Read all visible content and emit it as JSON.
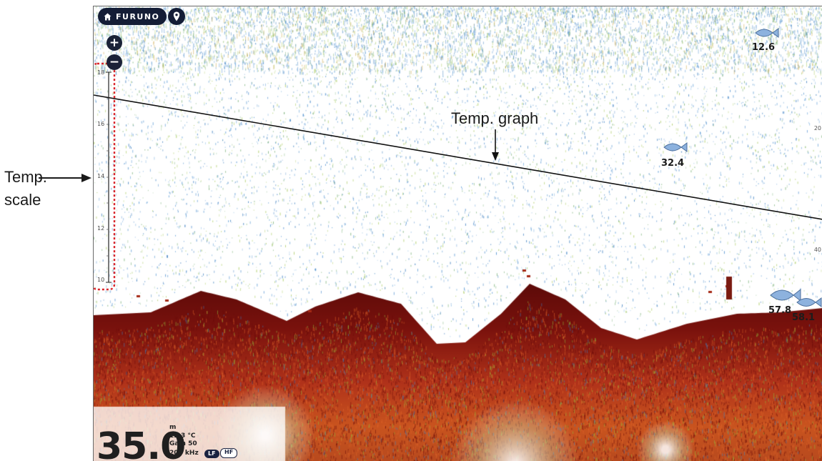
{
  "callouts": {
    "temp_scale_line1": "Temp.",
    "temp_scale_line2": "scale",
    "temp_graph": "Temp. graph"
  },
  "toolbar": {
    "brand": "FURUNO",
    "home_icon": "home-icon",
    "pin_icon": "location-pin-icon",
    "zoom_in": "+",
    "zoom_out": "−"
  },
  "temp_scale": {
    "ticks": [
      "18",
      "16",
      "14",
      "12",
      "10"
    ]
  },
  "depth_scale": {
    "ticks": [
      "20",
      "40"
    ]
  },
  "fish_marks": [
    {
      "label": "12.6",
      "icon": "fish-icon"
    },
    {
      "label": "32.4",
      "icon": "fish-icon"
    },
    {
      "label": "57.8",
      "icon": "fish-icon"
    },
    {
      "label": "58.1",
      "icon": "fish-icon"
    }
  ],
  "readout": {
    "depth": "35.0",
    "unit": "m",
    "water_temp": "12.3 °C",
    "gain": "Gain 50",
    "frequency": "200 kHz",
    "lf": "LF",
    "hf": "HF"
  },
  "colors": {
    "echo_bottom": "#6b0d0b",
    "echo_mid": "#c53a16",
    "echo_green": "#8fbf3c",
    "echo_blue": "#3d7fc0",
    "callout_box": "#d9252b",
    "button_bg": "#141d36"
  }
}
